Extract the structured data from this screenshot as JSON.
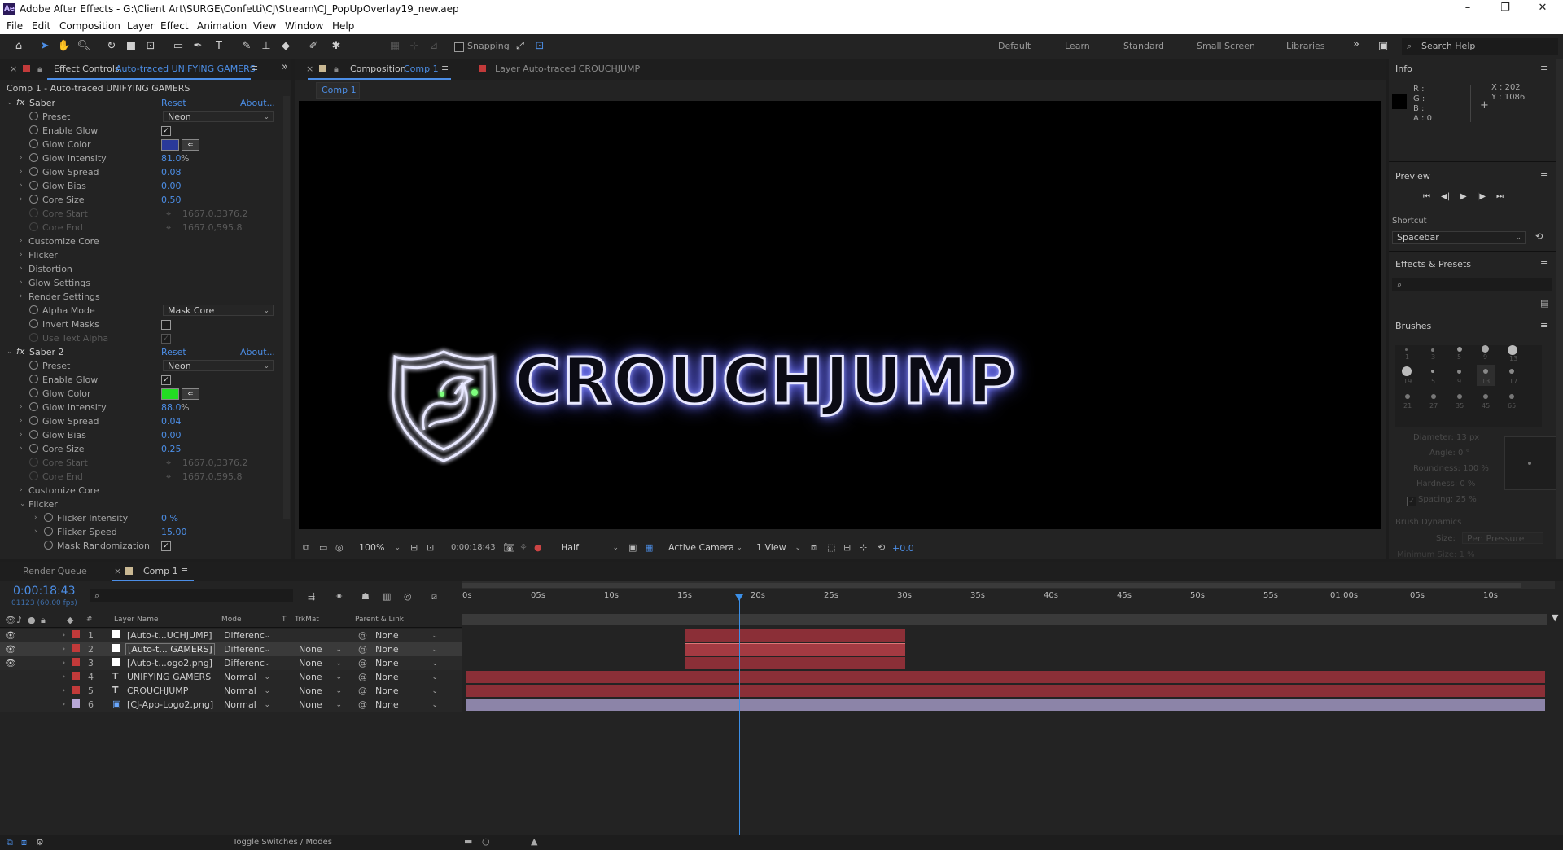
{
  "window": {
    "title": "Adobe After Effects - G:\\Client Art\\SURGE\\Confetti\\CJ\\Stream\\CJ_PopUpOverlay19_new.aep",
    "minimize": "–",
    "maximize": "❐",
    "close": "✕",
    "app_icon": "Ae"
  },
  "menu": [
    "File",
    "Edit",
    "Composition",
    "Layer",
    "Effect",
    "Animation",
    "View",
    "Window",
    "Help"
  ],
  "toolbar": {
    "snapping_label": "Snapping",
    "workspaces": [
      "Default",
      "Learn",
      "Standard",
      "Small Screen",
      "Libraries"
    ],
    "search_placeholder": "Search Help",
    "more": "»"
  },
  "effect_controls": {
    "tab_prefix": "Effect Controls",
    "tab_layer": "Auto-traced UNIFYING GAMERS",
    "breadcrumb": "Comp 1 - Auto-traced UNIFYING GAMERS",
    "saber1": {
      "name": "Saber",
      "reset": "Reset",
      "about": "About...",
      "preset_label": "Preset",
      "preset_value": "Neon",
      "enable_glow": "Enable Glow",
      "glow_color": "Glow Color",
      "glow_color_hex": "#2a3a9a",
      "glow_intensity": "Glow Intensity",
      "glow_intensity_val": "81.0",
      "pct": "%",
      "glow_spread": "Glow Spread",
      "glow_spread_val": "0.08",
      "glow_bias": "Glow Bias",
      "glow_bias_val": "0.00",
      "core_size": "Core Size",
      "core_size_val": "0.50",
      "core_start": "Core Start",
      "core_start_val": "1667.0,3376.2",
      "core_end": "Core End",
      "core_end_val": "1667.0,595.8",
      "groups": [
        "Customize Core",
        "Flicker",
        "Distortion",
        "Glow Settings",
        "Render Settings"
      ],
      "alpha_mode": "Alpha Mode",
      "alpha_mode_val": "Mask Core",
      "invert_masks": "Invert Masks",
      "use_text_alpha": "Use Text Alpha"
    },
    "saber2": {
      "name": "Saber 2",
      "reset": "Reset",
      "about": "About...",
      "preset_label": "Preset",
      "preset_value": "Neon",
      "enable_glow": "Enable Glow",
      "glow_color": "Glow Color",
      "glow_color_hex": "#22dd22",
      "glow_intensity": "Glow Intensity",
      "glow_intensity_val": "88.0",
      "pct": "%",
      "glow_spread": "Glow Spread",
      "glow_spread_val": "0.04",
      "glow_bias": "Glow Bias",
      "glow_bias_val": "0.00",
      "core_size": "Core Size",
      "core_size_val": "0.25",
      "core_start": "Core Start",
      "core_start_val": "1667.0,3376.2",
      "core_end": "Core End",
      "core_end_val": "1667.0,595.8",
      "customize_core": "Customize Core",
      "flicker": "Flicker",
      "flicker_intensity": "Flicker Intensity",
      "flicker_intensity_val": "0 %",
      "flicker_speed": "Flicker Speed",
      "flicker_speed_val": "15.00",
      "mask_randomization": "Mask Randomization"
    }
  },
  "composition": {
    "tab_prefix": "Composition",
    "tab_name": "Comp 1",
    "layer_tab": "Layer Auto-traced CROUCHJUMP",
    "crumb": "Comp 1",
    "display_text": "CROUCHJUMP",
    "zoom": "100%",
    "timecode": "0:00:18:43",
    "resolution": "Half",
    "camera": "Active Camera",
    "views": "1 View",
    "exposure": "+0.0"
  },
  "info": {
    "title": "Info",
    "r": "R :",
    "g": "G :",
    "b": "B :",
    "a": "A : 0",
    "x": "X : 202",
    "y": "Y : 1086"
  },
  "preview": {
    "title": "Preview",
    "shortcut_label": "Shortcut",
    "shortcut_value": "Spacebar"
  },
  "effects_presets": {
    "title": "Effects & Presets"
  },
  "brushes": {
    "title": "Brushes",
    "sizes": [
      "1",
      "3",
      "5",
      "9",
      "13",
      "19",
      "5",
      "9",
      "13",
      "17",
      "21",
      "27",
      "35",
      "45",
      "65"
    ],
    "diameter": "Diameter: 13 px",
    "angle": "Angle: 0 °",
    "roundness": "Roundness: 100 %",
    "hardness": "Hardness: 0 %",
    "spacing": "Spacing: 25 %",
    "dynamics": "Brush Dynamics",
    "size_label": "Size:",
    "size_value": "Pen Pressure",
    "min_size": "Minimum Size: 1 %"
  },
  "timeline": {
    "render_queue": "Render Queue",
    "comp_tab": "Comp 1",
    "timecode": "0:00:18:43",
    "frames": "01123 (60.00 fps)",
    "col_layer_name": "Layer Name",
    "col_mode": "Mode",
    "col_t": "T",
    "col_trkmat": "TrkMat",
    "col_parent": "Parent & Link",
    "toggle": "Toggle Switches / Modes",
    "ruler": [
      "0s",
      "05s",
      "10s",
      "15s",
      "20s",
      "25s",
      "30s",
      "35s",
      "40s",
      "45s",
      "50s",
      "55s",
      "01:00s",
      "05s",
      "10s"
    ],
    "layers": [
      {
        "num": "1",
        "name": "[Auto-t...UCHJUMP]",
        "mode": "Differenc",
        "trkmat": "",
        "parent": "None",
        "label": "#c23a3a",
        "type": "solid"
      },
      {
        "num": "2",
        "name": "[Auto-t... GAMERS]",
        "mode": "Differenc",
        "trkmat": "None",
        "parent": "None",
        "label": "#c23a3a",
        "type": "solid"
      },
      {
        "num": "3",
        "name": "[Auto-t...ogo2.png]",
        "mode": "Differenc",
        "trkmat": "None",
        "parent": "None",
        "label": "#c23a3a",
        "type": "solid"
      },
      {
        "num": "4",
        "name": "UNIFYING GAMERS",
        "mode": "Normal",
        "trkmat": "None",
        "parent": "None",
        "label": "#c23a3a",
        "type": "text"
      },
      {
        "num": "5",
        "name": "CROUCHJUMP",
        "mode": "Normal",
        "trkmat": "None",
        "parent": "None",
        "label": "#c23a3a",
        "type": "text"
      },
      {
        "num": "6",
        "name": "[CJ-App-Logo2.png]",
        "mode": "Normal",
        "trkmat": "None",
        "parent": "None",
        "label": "#b9a8d8",
        "type": "image"
      }
    ]
  },
  "colors": {
    "accent": "#4c8ee6",
    "bar_red": "#8b2f37",
    "bar_red_sel": "#a43a42",
    "bar_lav": "#8c84a8",
    "playhead": "#3b8fe8"
  }
}
